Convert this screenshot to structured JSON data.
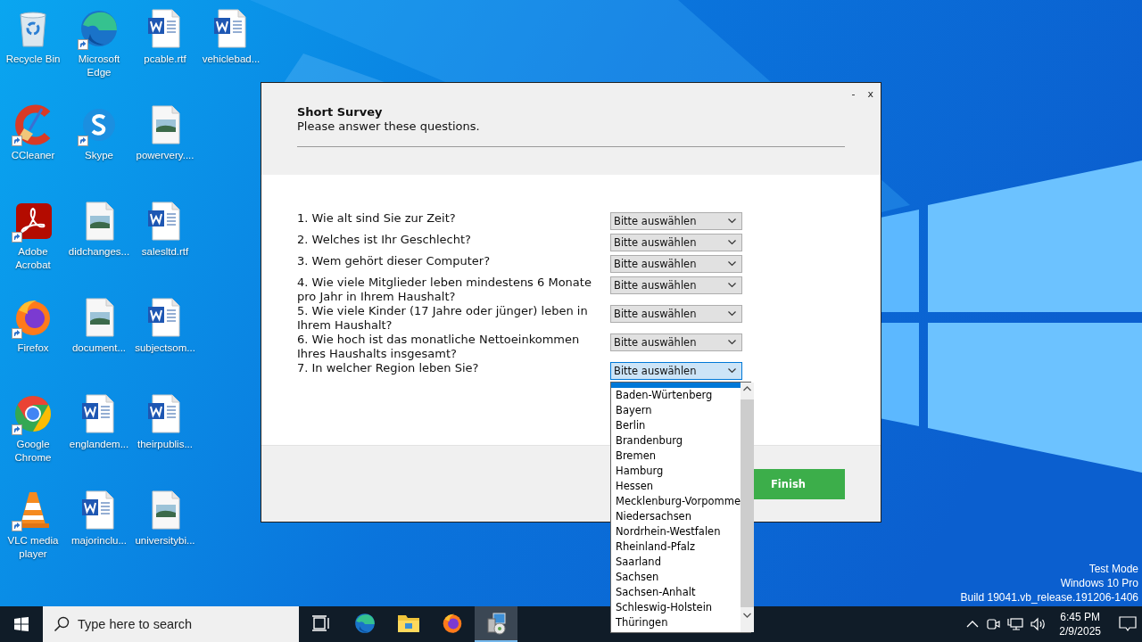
{
  "desktop_icons": [
    {
      "label": "Recycle Bin",
      "kind": "recycle",
      "shortcut": false
    },
    {
      "label": "CCleaner",
      "kind": "cleaner",
      "shortcut": true
    },
    {
      "label": "Adobe Acrobat",
      "kind": "pdf",
      "shortcut": true
    },
    {
      "label": "Firefox",
      "kind": "firefox",
      "shortcut": true
    },
    {
      "label": "Google Chrome",
      "kind": "chrome",
      "shortcut": true
    },
    {
      "label": "VLC media player",
      "kind": "cone",
      "shortcut": true
    },
    {
      "label": "Microsoft Edge",
      "kind": "edge",
      "shortcut": true
    },
    {
      "label": "Skype",
      "kind": "chat",
      "shortcut": true
    },
    {
      "label": "didchanges...",
      "kind": "image",
      "shortcut": false
    },
    {
      "label": "document...",
      "kind": "image",
      "shortcut": false
    },
    {
      "label": "englandem...",
      "kind": "word",
      "shortcut": false
    },
    {
      "label": "majorinclu...",
      "kind": "word",
      "shortcut": false
    },
    {
      "label": "pcable.rtf",
      "kind": "word",
      "shortcut": false
    },
    {
      "label": "powervery....",
      "kind": "image",
      "shortcut": false
    },
    {
      "label": "salesltd.rtf",
      "kind": "word",
      "shortcut": false
    },
    {
      "label": "subjectsom...",
      "kind": "word",
      "shortcut": false
    },
    {
      "label": "theirpublis...",
      "kind": "word",
      "shortcut": false
    },
    {
      "label": "universitybi...",
      "kind": "image",
      "shortcut": false
    },
    {
      "label": "vehiclebad...",
      "kind": "word",
      "shortcut": false
    }
  ],
  "dialog": {
    "controls": [
      "-",
      "x"
    ],
    "title": "Short Survey",
    "subtitle": "Please answer these questions.",
    "questions": [
      {
        "label_lines": [
          "1. Wie alt sind Sie zur Zeit?"
        ],
        "value": "Bitte auswählen",
        "focused": false
      },
      {
        "label_lines": [
          "2. Welches ist Ihr Geschlecht?"
        ],
        "value": "Bitte auswählen",
        "focused": false
      },
      {
        "label_lines": [
          "3. Wem gehört dieser Computer?"
        ],
        "value": "Bitte auswählen",
        "focused": false
      },
      {
        "label_lines": [
          "4. Wie viele Mitglieder leben mindestens 6 Monate",
          "pro Jahr in Ihrem Haushalt?"
        ],
        "value": "Bitte auswählen",
        "focused": false
      },
      {
        "label_lines": [
          "5. Wie viele Kinder (17 Jahre oder jünger) leben in",
          "Ihrem Haushalt?"
        ],
        "value": "Bitte auswählen",
        "focused": false
      },
      {
        "label_lines": [
          "6. Wie hoch ist das monatliche Nettoeinkommen",
          "Ihres Haushalts insgesamt?"
        ],
        "value": "Bitte auswählen",
        "focused": false
      },
      {
        "label_lines": [
          "7. In welcher Region leben Sie?"
        ],
        "value": "Bitte auswählen",
        "focused": true
      }
    ],
    "finish_button": "Finish"
  },
  "dropdown_list": {
    "options": [
      "Baden-Würtenberg",
      "Bayern",
      "Berlin",
      "Brandenburg",
      "Bremen",
      "Hamburg",
      "Hessen",
      "Mecklenburg-Vorpomme",
      "Niedersachsen",
      "Nordrhein-Westfalen",
      "Rheinland-Pfalz",
      "Saarland",
      "Sachsen",
      "Sachsen-Anhalt",
      "Schleswig-Holstein",
      "Thüringen"
    ]
  },
  "system_info": [
    "Test Mode",
    "Windows 10 Pro",
    "Build 19041.vb_release.191206-1406"
  ],
  "taskbar": {
    "search": {
      "placeholder": "Type here to search"
    },
    "apps": [
      {
        "kind": "taskview",
        "active": false
      },
      {
        "kind": "edge",
        "active": false
      },
      {
        "kind": "folder",
        "active": false
      },
      {
        "kind": "firefox",
        "active": false
      },
      {
        "kind": "installer",
        "active": true
      }
    ],
    "tray": {
      "time": "6:45 PM",
      "date": "2/9/2025"
    }
  }
}
